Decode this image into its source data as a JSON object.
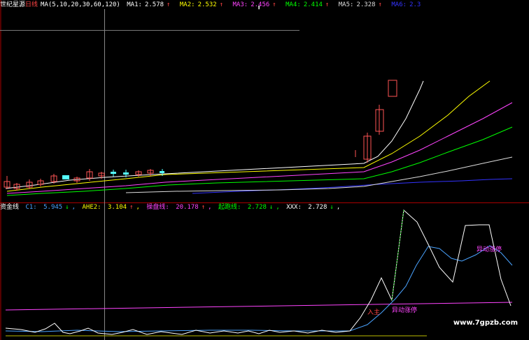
{
  "top_header": {
    "stock_name": "世纪星源",
    "period": "日线",
    "ma_params": "MA(5,10,20,30,60,120)",
    "items": [
      {
        "label": "MA1:",
        "value": "2.578",
        "arrow": "↑",
        "color": "#ffffff"
      },
      {
        "label": "MA2:",
        "value": "2.532",
        "arrow": "↑",
        "color": "#ffff00"
      },
      {
        "label": "MA3:",
        "value": "2.456",
        "arrow": "↑",
        "color": "#ff44ff"
      },
      {
        "label": "MA4:",
        "value": "2.414",
        "arrow": "↑",
        "color": "#00ff00"
      },
      {
        "label": "MA5:",
        "value": "2.328",
        "arrow": "↑",
        "color": "#dddddd"
      },
      {
        "label": "MA6:",
        "value": "2.3",
        "arrow": "",
        "color": "#3333ff"
      }
    ]
  },
  "bottom_header": {
    "indicator": "资金线",
    "items": [
      {
        "label": "C1:",
        "value": "5.945",
        "arrow": "↓",
        "color": "#4aa3ff"
      },
      {
        "label": "AHE2:",
        "value": "3.104",
        "arrow": "↑",
        "color": "#ffff00"
      },
      {
        "label": "操盘线:",
        "value": "20.178",
        "arrow": "↑",
        "color": "#ff44ff"
      },
      {
        "label": "起跑线:",
        "value": "2.728",
        "arrow": "↓",
        "color": "#00ff00"
      },
      {
        "label": "XXX:",
        "value": "2.728",
        "arrow": "↓",
        "color": "#ffffff"
      }
    ]
  },
  "annotations": {
    "entry_label": "入主",
    "move_label_lower": "异动涨停",
    "move_label_upper": "异动涨停"
  },
  "watermark": "www.7gpzb.com",
  "colors": {
    "up_candle": "#ff5555",
    "down_candle": "#55ffff",
    "frame": "#aa0000",
    "crosshair": "#888888"
  }
}
